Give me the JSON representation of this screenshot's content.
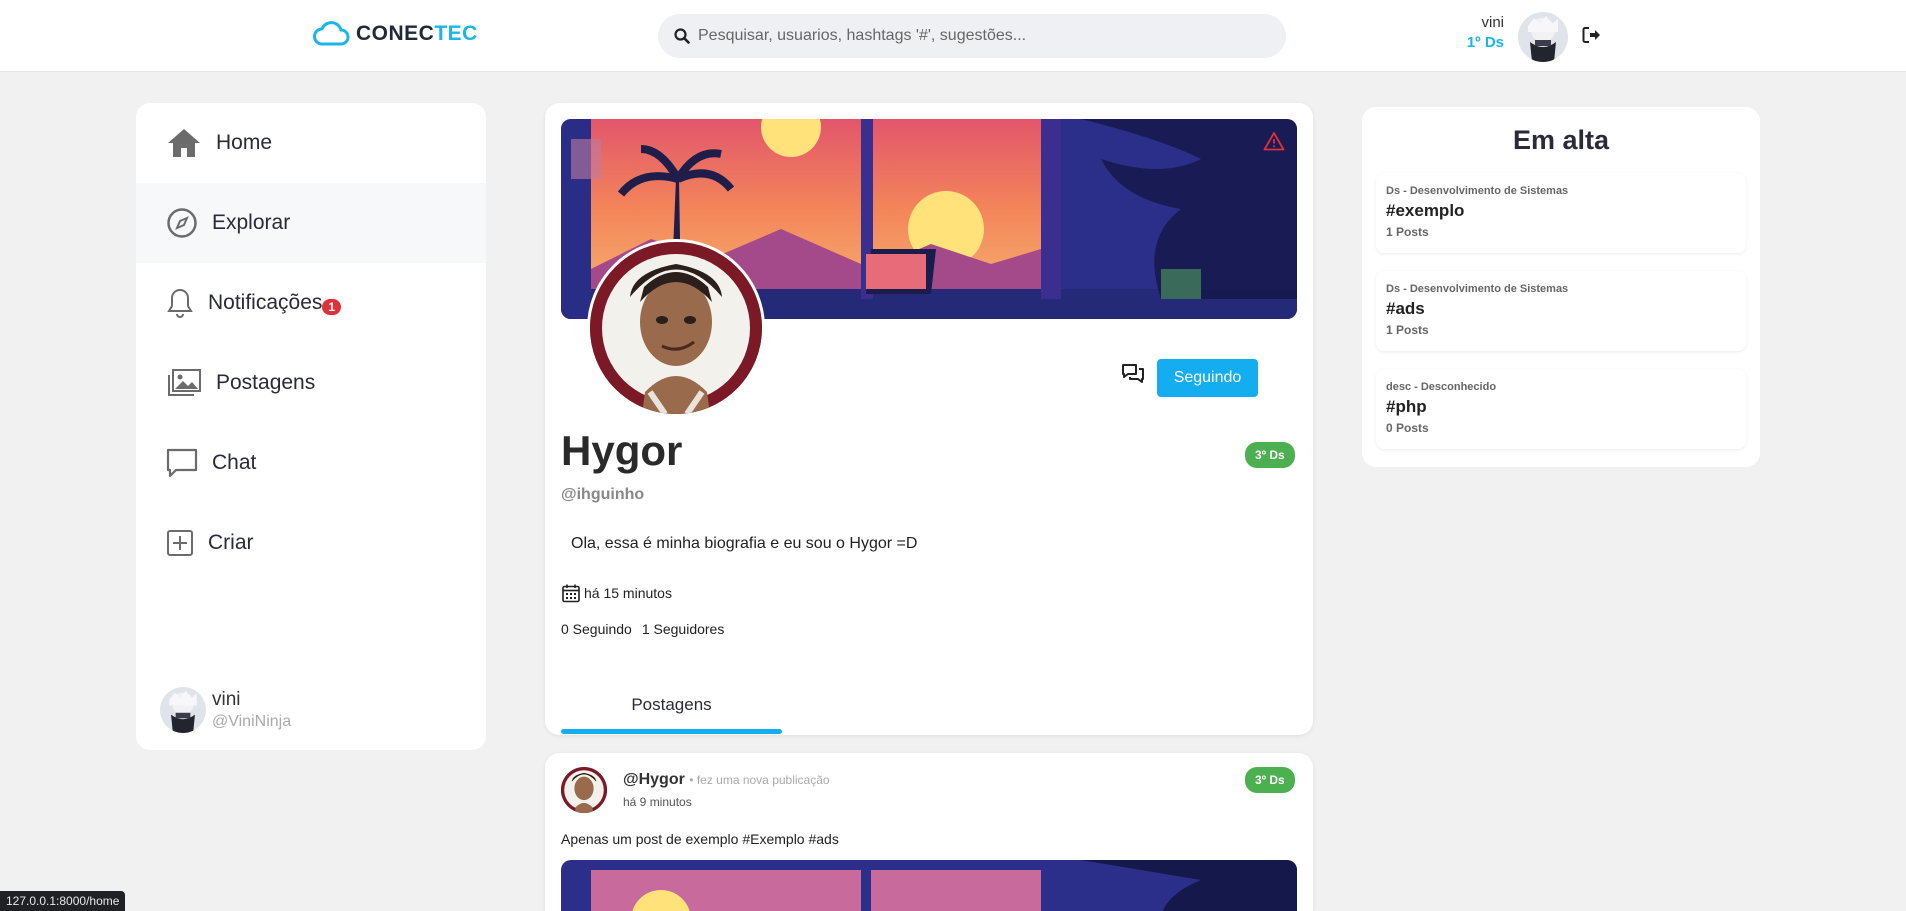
{
  "header": {
    "logo_part1": "CONEC",
    "logo_part2": "TEC",
    "search_placeholder": "Pesquisar, usuarios, hashtags '#', sugestões...",
    "user_name": "vini",
    "user_class": "1º Ds"
  },
  "sidebar": {
    "items": [
      {
        "label": "Home",
        "icon": "home-icon"
      },
      {
        "label": "Explorar",
        "icon": "compass-icon"
      },
      {
        "label": "Notificações",
        "icon": "bell-icon",
        "badge": "1"
      },
      {
        "label": "Postagens",
        "icon": "images-icon"
      },
      {
        "label": "Chat",
        "icon": "chat-icon"
      },
      {
        "label": "Criar",
        "icon": "plus-square-icon"
      }
    ],
    "user": {
      "name": "vini",
      "handle": "@ViniNinja"
    }
  },
  "profile": {
    "name": "Hygor",
    "handle": "@ihguinho",
    "class_badge": "3º Ds",
    "follow_label": "Seguindo",
    "bio": "Ola, essa é minha biografia e eu sou o Hygor =D",
    "joined": "há 15 minutos",
    "following": "0 Seguindo",
    "followers": "1 Seguidores",
    "tab_label": "Postagens"
  },
  "post": {
    "author": "@Hygor",
    "action": "• fez uma nova publicação",
    "time": "há 9 minutos",
    "class_badge": "3º Ds",
    "text": "Apenas um post de exemplo #Exemplo #ads"
  },
  "trending": {
    "title": "Em alta",
    "items": [
      {
        "category": "Ds - Desenvolvimento de Sistemas",
        "tag": "#exemplo",
        "count": "1 Posts"
      },
      {
        "category": "Ds - Desenvolvimento de Sistemas",
        "tag": "#ads",
        "count": "1 Posts"
      },
      {
        "category": "desc - Desconhecido",
        "tag": "#php",
        "count": "0 Posts"
      }
    ]
  },
  "status_bar": {
    "url": "127.0.0.1:8000/home"
  },
  "colors": {
    "accent": "#1bb5e8",
    "button": "#14aef0",
    "badge_green": "#4caf50",
    "notification_red": "#e0303a"
  }
}
